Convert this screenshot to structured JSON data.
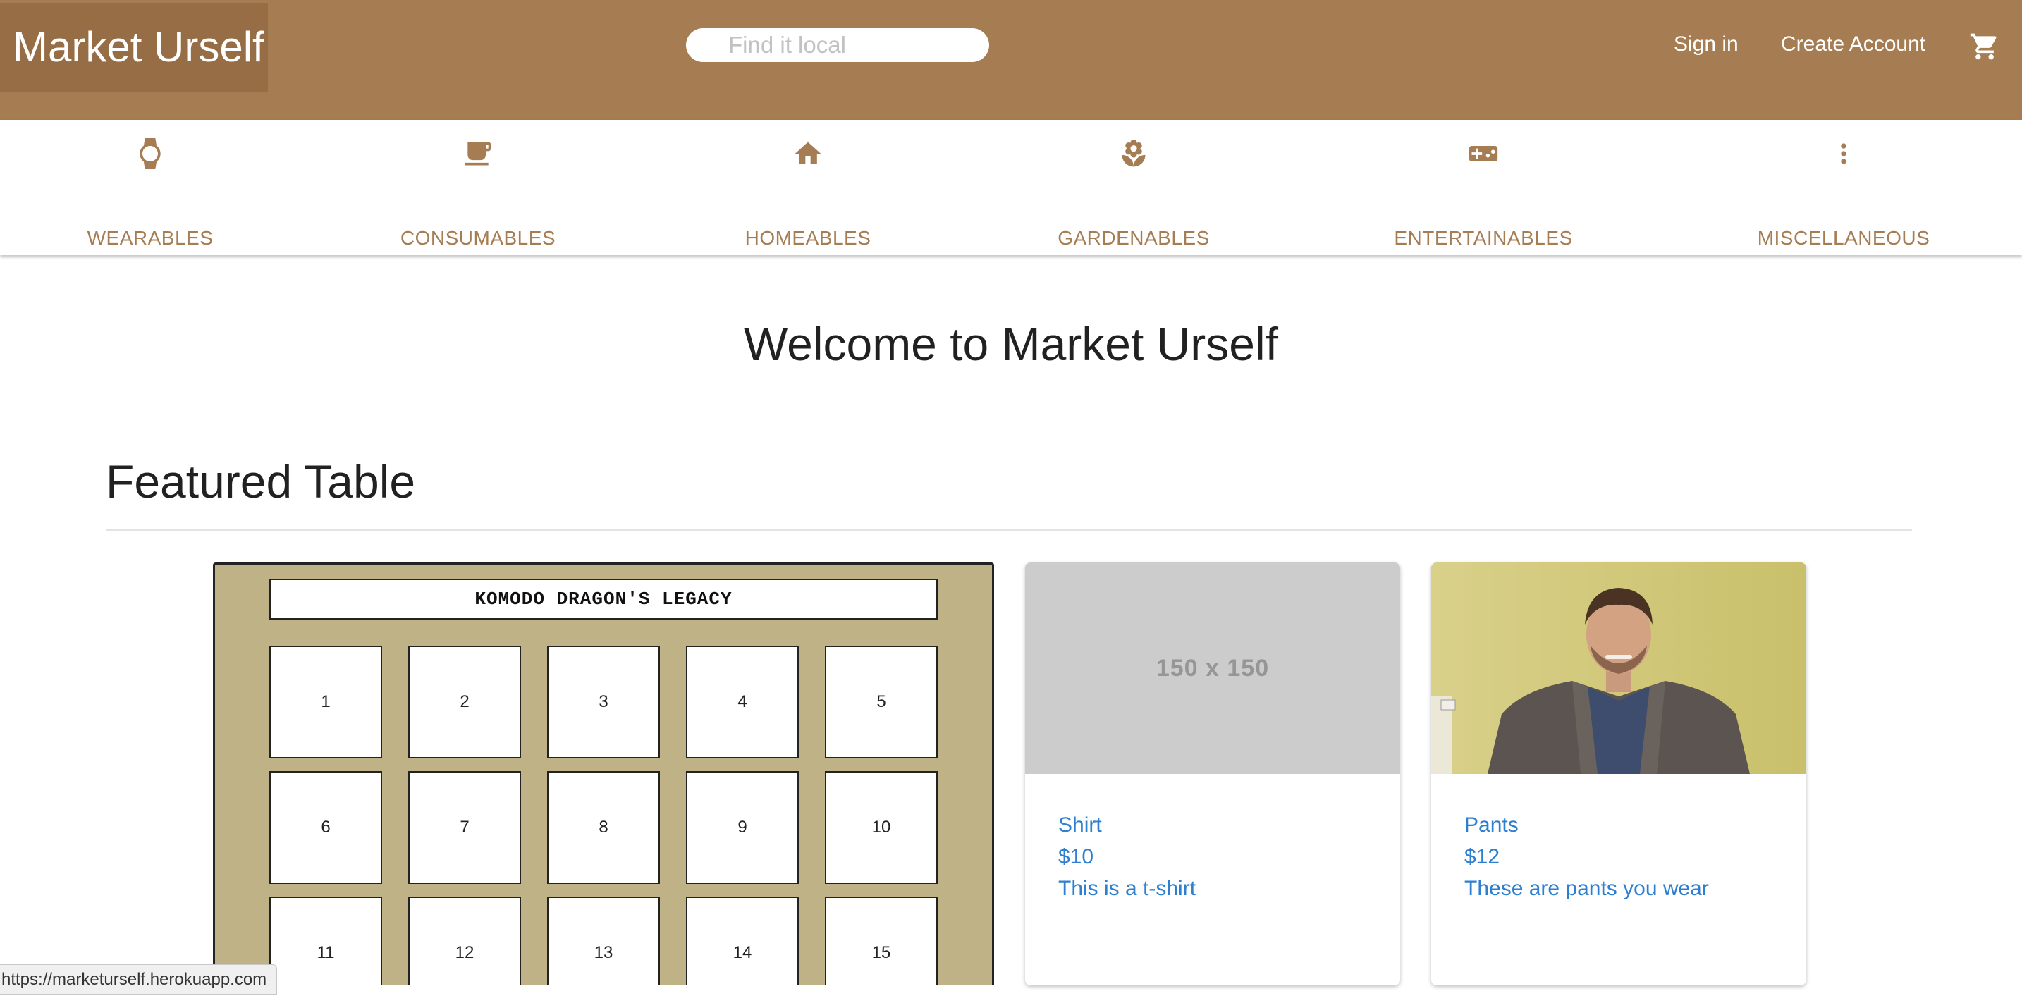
{
  "header": {
    "logo": "Market Urself",
    "search_placeholder": "Find it local",
    "sign_in": "Sign in",
    "create_account": "Create Account",
    "cart_icon": "shopping-cart-icon",
    "background_color": "#a67c52"
  },
  "categories": [
    {
      "label": "WEARABLES",
      "icon": "watch-icon"
    },
    {
      "label": "CONSUMABLES",
      "icon": "cup-icon"
    },
    {
      "label": "HOMEABLES",
      "icon": "home-icon"
    },
    {
      "label": "GARDENABLES",
      "icon": "flower-icon"
    },
    {
      "label": "ENTERTAINABLES",
      "icon": "gamepad-icon"
    },
    {
      "label": "MISCELLANEOUS",
      "icon": "more-vertical-icon"
    }
  ],
  "main": {
    "welcome": "Welcome to Market Urself",
    "featured_title": "Featured Table"
  },
  "board": {
    "title": "KOMODO DRAGON'S LEGACY",
    "tiles": [
      "1",
      "2",
      "3",
      "4",
      "5",
      "6",
      "7",
      "8",
      "9",
      "10",
      "11",
      "12",
      "13",
      "14",
      "15"
    ],
    "background_color": "#bfb286"
  },
  "products": [
    {
      "image_text": "150 x 150",
      "name": "Shirt",
      "price": "$10",
      "description": "This is a t-shirt"
    },
    {
      "image": "photo of man in gray blazer",
      "name": "Pants",
      "price": "$12",
      "description": "These are pants you wear"
    }
  ],
  "status_bar": {
    "url": "https://marketurself.herokuapp.com"
  },
  "colors": {
    "brand": "#a67c52",
    "link": "#2e7fcf"
  }
}
